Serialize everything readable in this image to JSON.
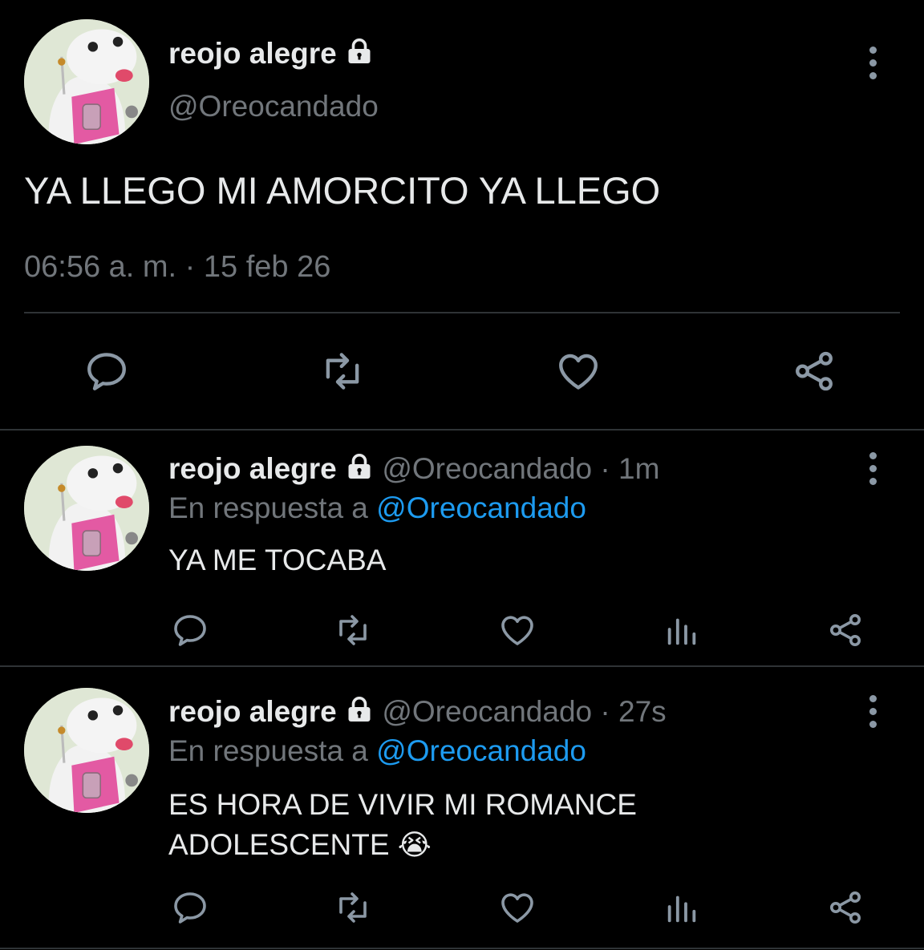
{
  "colors": {
    "background": "#000000",
    "text": "#e7e9ea",
    "muted": "#71767b",
    "link": "#1d9bf0",
    "icon": "#8b98a5"
  },
  "main_tweet": {
    "display_name": "reojo alegre",
    "handle": "@Oreocandado",
    "text": "YA LLEGO MI AMORCITO YA LLEGO",
    "timestamp": "06:56 a. m. · 15 feb 26",
    "actions": [
      "reply-icon",
      "retweet-icon",
      "like-icon",
      "share-icon"
    ]
  },
  "replies": [
    {
      "display_name": "reojo alegre",
      "handle": "@Oreocandado",
      "time": "· 1m",
      "reply_prefix": "En respuesta a",
      "reply_to": "@Oreocandado",
      "text_line1": "YA ME TOCABA",
      "text_line2": "",
      "emoji": "",
      "actions": [
        "reply-icon",
        "retweet-icon",
        "like-icon",
        "analytics-icon",
        "share-icon"
      ]
    },
    {
      "display_name": "reojo alegre",
      "handle": "@Oreocandado",
      "time": "· 27s",
      "reply_prefix": "En respuesta a",
      "reply_to": "@Oreocandado",
      "text_line1": "ES HORA DE VIVIR MI ROMANCE",
      "text_line2": "ADOLESCENTE",
      "emoji": "😭",
      "actions": [
        "reply-icon",
        "retweet-icon",
        "like-icon",
        "analytics-icon",
        "share-icon"
      ]
    }
  ]
}
